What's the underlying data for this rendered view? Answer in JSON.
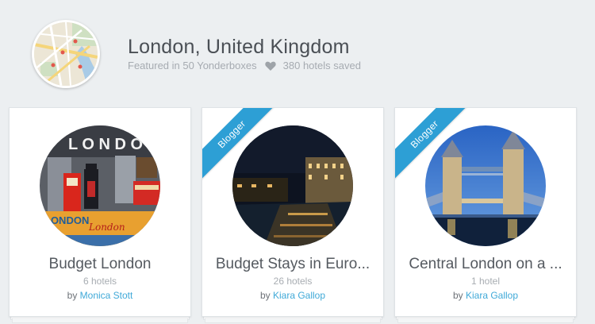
{
  "header": {
    "title": "London, United Kingdom",
    "featured": "Featured in 50 Yonderboxes",
    "saved": "380 hotels saved"
  },
  "cards": [
    {
      "title": "Budget London",
      "count": "6 hotels",
      "by": "by",
      "author": "Monica Stott",
      "ribbon": ""
    },
    {
      "title": "Budget Stays in Euro...",
      "count": "26 hotels",
      "by": "by",
      "author": "Kiara Gallop",
      "ribbon": "Blogger"
    },
    {
      "title": "Central London on a ...",
      "count": "1 hotel",
      "by": "by",
      "author": "Kiara Gallop",
      "ribbon": "Blogger"
    }
  ],
  "colors": {
    "accent": "#2d9fd5",
    "link": "#3fa9d8",
    "background": "#eceff1"
  }
}
